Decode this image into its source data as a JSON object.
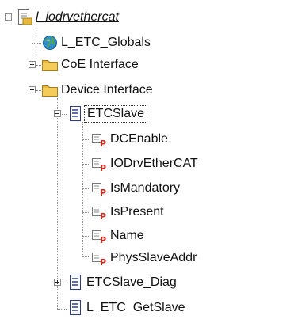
{
  "tree": {
    "root": {
      "label": "l_iodrvethercat",
      "icon": "library-document-icon"
    },
    "globals": {
      "label": "L_ETC_Globals",
      "icon": "globe-icon"
    },
    "coe_interface": {
      "label": "CoE Interface",
      "icon": "folder-icon"
    },
    "device_interface": {
      "label": "Device Interface",
      "icon": "folder-icon"
    },
    "etcslave": {
      "label": "ETCSlave",
      "icon": "function-block-icon"
    },
    "properties": [
      {
        "label": "DCEnable",
        "icon": "property-icon"
      },
      {
        "label": "IODrvEtherCAT",
        "icon": "property-icon"
      },
      {
        "label": "IsMandatory",
        "icon": "property-icon"
      },
      {
        "label": "IsPresent",
        "icon": "property-icon"
      },
      {
        "label": "Name",
        "icon": "property-icon"
      },
      {
        "label": "PhysSlaveAddr",
        "icon": "property-icon"
      }
    ],
    "etcslave_diag": {
      "label": "ETCSlave_Diag",
      "icon": "function-block-icon"
    },
    "get_slave": {
      "label": "L_ETC_GetSlave",
      "icon": "function-block-icon"
    }
  },
  "colors": {
    "folder": "#e9b73c",
    "property_badge": "#d6261c",
    "globe": "#2f8fd0",
    "selection_border": "#333333"
  }
}
